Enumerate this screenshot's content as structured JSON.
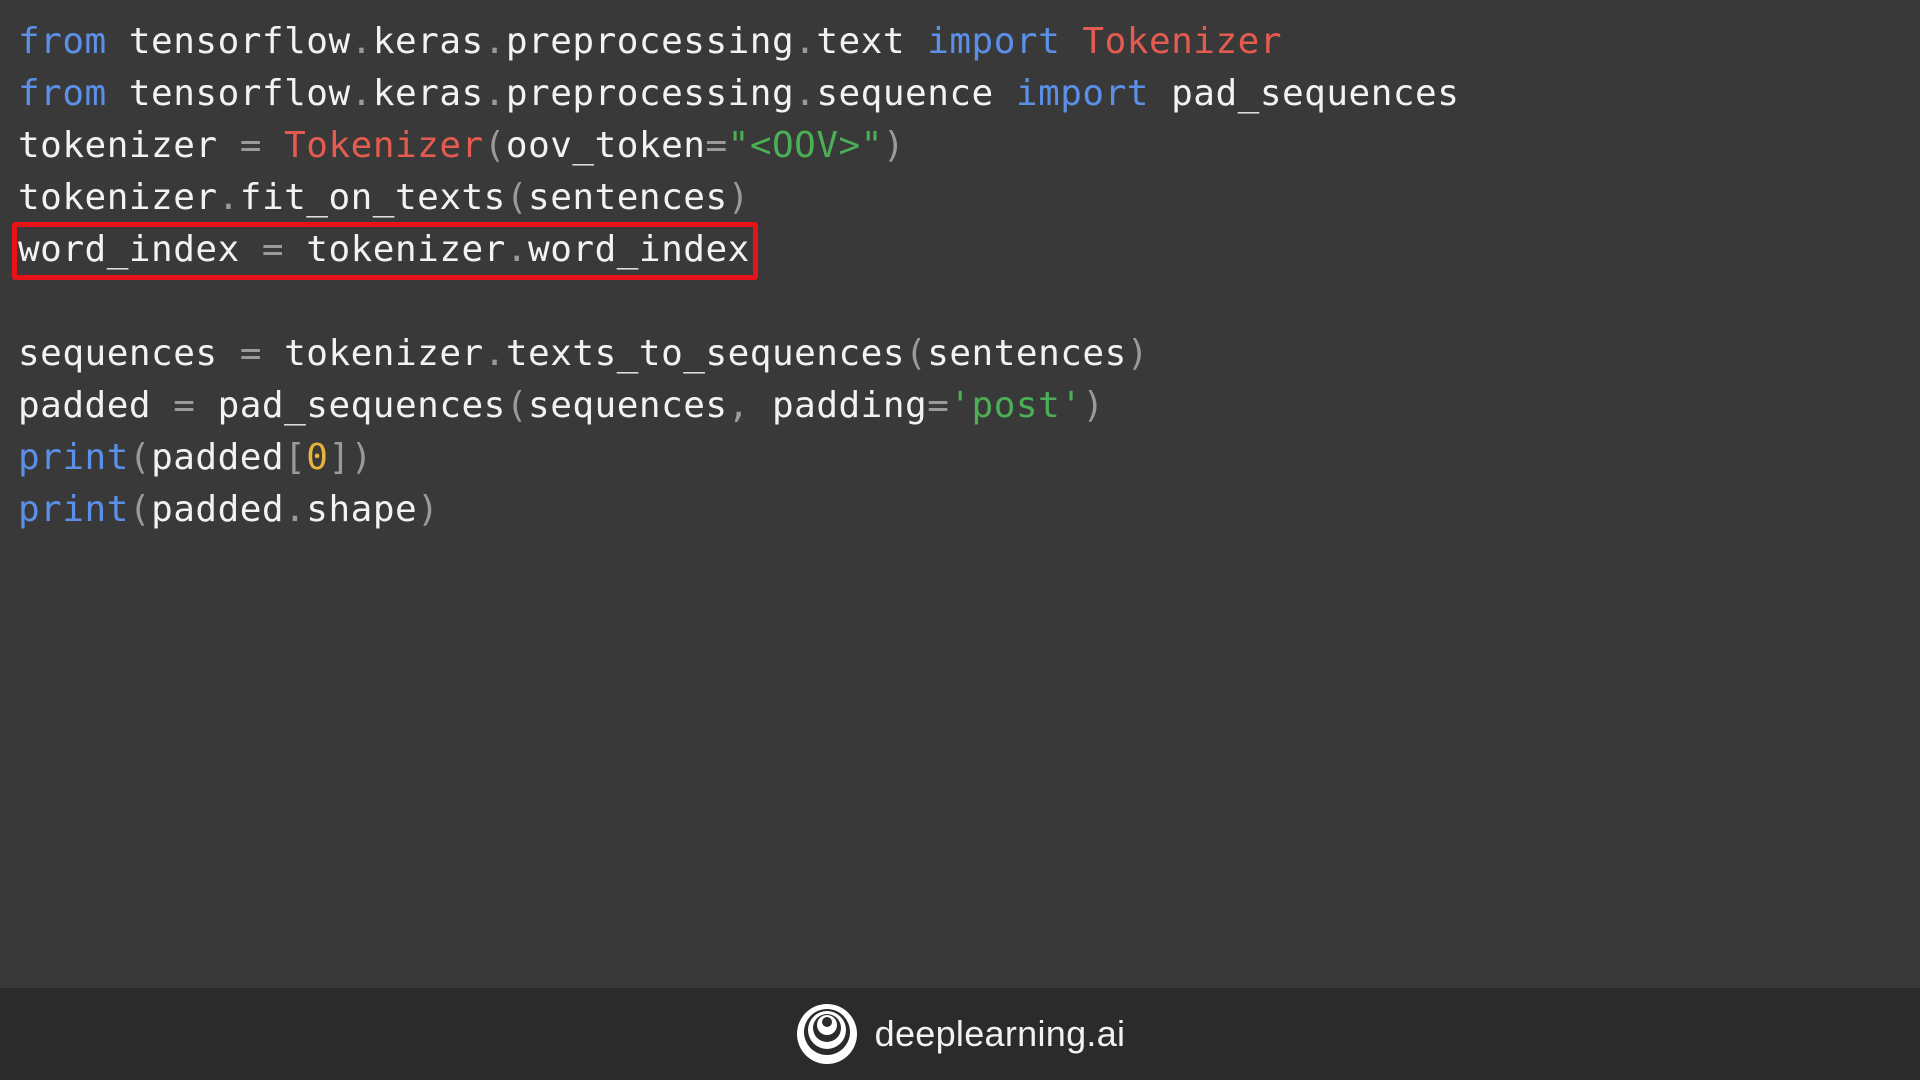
{
  "colors": {
    "background": "#393939",
    "footer_background": "#2b2b2b",
    "default": "#f2f2f2",
    "keyword": "#5b8fe8",
    "class": "#e55b4f",
    "string": "#4cae55",
    "punct": "#9a9a9a",
    "number": "#e8b43a",
    "highlight_border": "#e8121b"
  },
  "code": {
    "highlighted_line_index": 4,
    "lines": [
      [
        {
          "t": "from",
          "k": "keyword"
        },
        {
          "t": " tensorflow",
          "k": "default"
        },
        {
          "t": ".",
          "k": "punct"
        },
        {
          "t": "keras",
          "k": "default"
        },
        {
          "t": ".",
          "k": "punct"
        },
        {
          "t": "preprocessing",
          "k": "default"
        },
        {
          "t": ".",
          "k": "punct"
        },
        {
          "t": "text ",
          "k": "default"
        },
        {
          "t": "import",
          "k": "keyword"
        },
        {
          "t": " Tokenizer",
          "k": "class"
        }
      ],
      [
        {
          "t": "from",
          "k": "keyword"
        },
        {
          "t": " tensorflow",
          "k": "default"
        },
        {
          "t": ".",
          "k": "punct"
        },
        {
          "t": "keras",
          "k": "default"
        },
        {
          "t": ".",
          "k": "punct"
        },
        {
          "t": "preprocessing",
          "k": "default"
        },
        {
          "t": ".",
          "k": "punct"
        },
        {
          "t": "sequence ",
          "k": "default"
        },
        {
          "t": "import",
          "k": "keyword"
        },
        {
          "t": " pad_sequences",
          "k": "default"
        }
      ],
      [
        {
          "t": "tokenizer ",
          "k": "default"
        },
        {
          "t": "=",
          "k": "punct"
        },
        {
          "t": " ",
          "k": "default"
        },
        {
          "t": "Tokenizer",
          "k": "class"
        },
        {
          "t": "(",
          "k": "punct"
        },
        {
          "t": "oov_token",
          "k": "default"
        },
        {
          "t": "=",
          "k": "punct"
        },
        {
          "t": "\"<OOV>\"",
          "k": "string"
        },
        {
          "t": ")",
          "k": "punct"
        }
      ],
      [
        {
          "t": "tokenizer",
          "k": "default"
        },
        {
          "t": ".",
          "k": "punct"
        },
        {
          "t": "fit_on_texts",
          "k": "default"
        },
        {
          "t": "(",
          "k": "punct"
        },
        {
          "t": "sentences",
          "k": "default"
        },
        {
          "t": ")",
          "k": "punct"
        }
      ],
      [
        {
          "t": "word_index ",
          "k": "default"
        },
        {
          "t": "=",
          "k": "punct"
        },
        {
          "t": " tokenizer",
          "k": "default"
        },
        {
          "t": ".",
          "k": "punct"
        },
        {
          "t": "word_index",
          "k": "default"
        }
      ],
      [],
      [
        {
          "t": "sequences ",
          "k": "default"
        },
        {
          "t": "=",
          "k": "punct"
        },
        {
          "t": " tokenizer",
          "k": "default"
        },
        {
          "t": ".",
          "k": "punct"
        },
        {
          "t": "texts_to_sequences",
          "k": "default"
        },
        {
          "t": "(",
          "k": "punct"
        },
        {
          "t": "sentences",
          "k": "default"
        },
        {
          "t": ")",
          "k": "punct"
        }
      ],
      [
        {
          "t": "padded ",
          "k": "default"
        },
        {
          "t": "=",
          "k": "punct"
        },
        {
          "t": " pad_sequences",
          "k": "default"
        },
        {
          "t": "(",
          "k": "punct"
        },
        {
          "t": "sequences",
          "k": "default"
        },
        {
          "t": ",",
          "k": "punct"
        },
        {
          "t": " padding",
          "k": "default"
        },
        {
          "t": "=",
          "k": "punct"
        },
        {
          "t": "'post'",
          "k": "string"
        },
        {
          "t": ")",
          "k": "punct"
        }
      ],
      [
        {
          "t": "print",
          "k": "keyword"
        },
        {
          "t": "(",
          "k": "punct"
        },
        {
          "t": "padded",
          "k": "default"
        },
        {
          "t": "[",
          "k": "punct"
        },
        {
          "t": "0",
          "k": "number"
        },
        {
          "t": "])",
          "k": "punct"
        }
      ],
      [
        {
          "t": "print",
          "k": "keyword"
        },
        {
          "t": "(",
          "k": "punct"
        },
        {
          "t": "padded",
          "k": "default"
        },
        {
          "t": ".",
          "k": "punct"
        },
        {
          "t": "shape",
          "k": "default"
        },
        {
          "t": ")",
          "k": "punct"
        }
      ]
    ]
  },
  "footer": {
    "brand_text": "deeplearning.ai",
    "logo_icon": "deeplearning-ai-logo-icon"
  }
}
